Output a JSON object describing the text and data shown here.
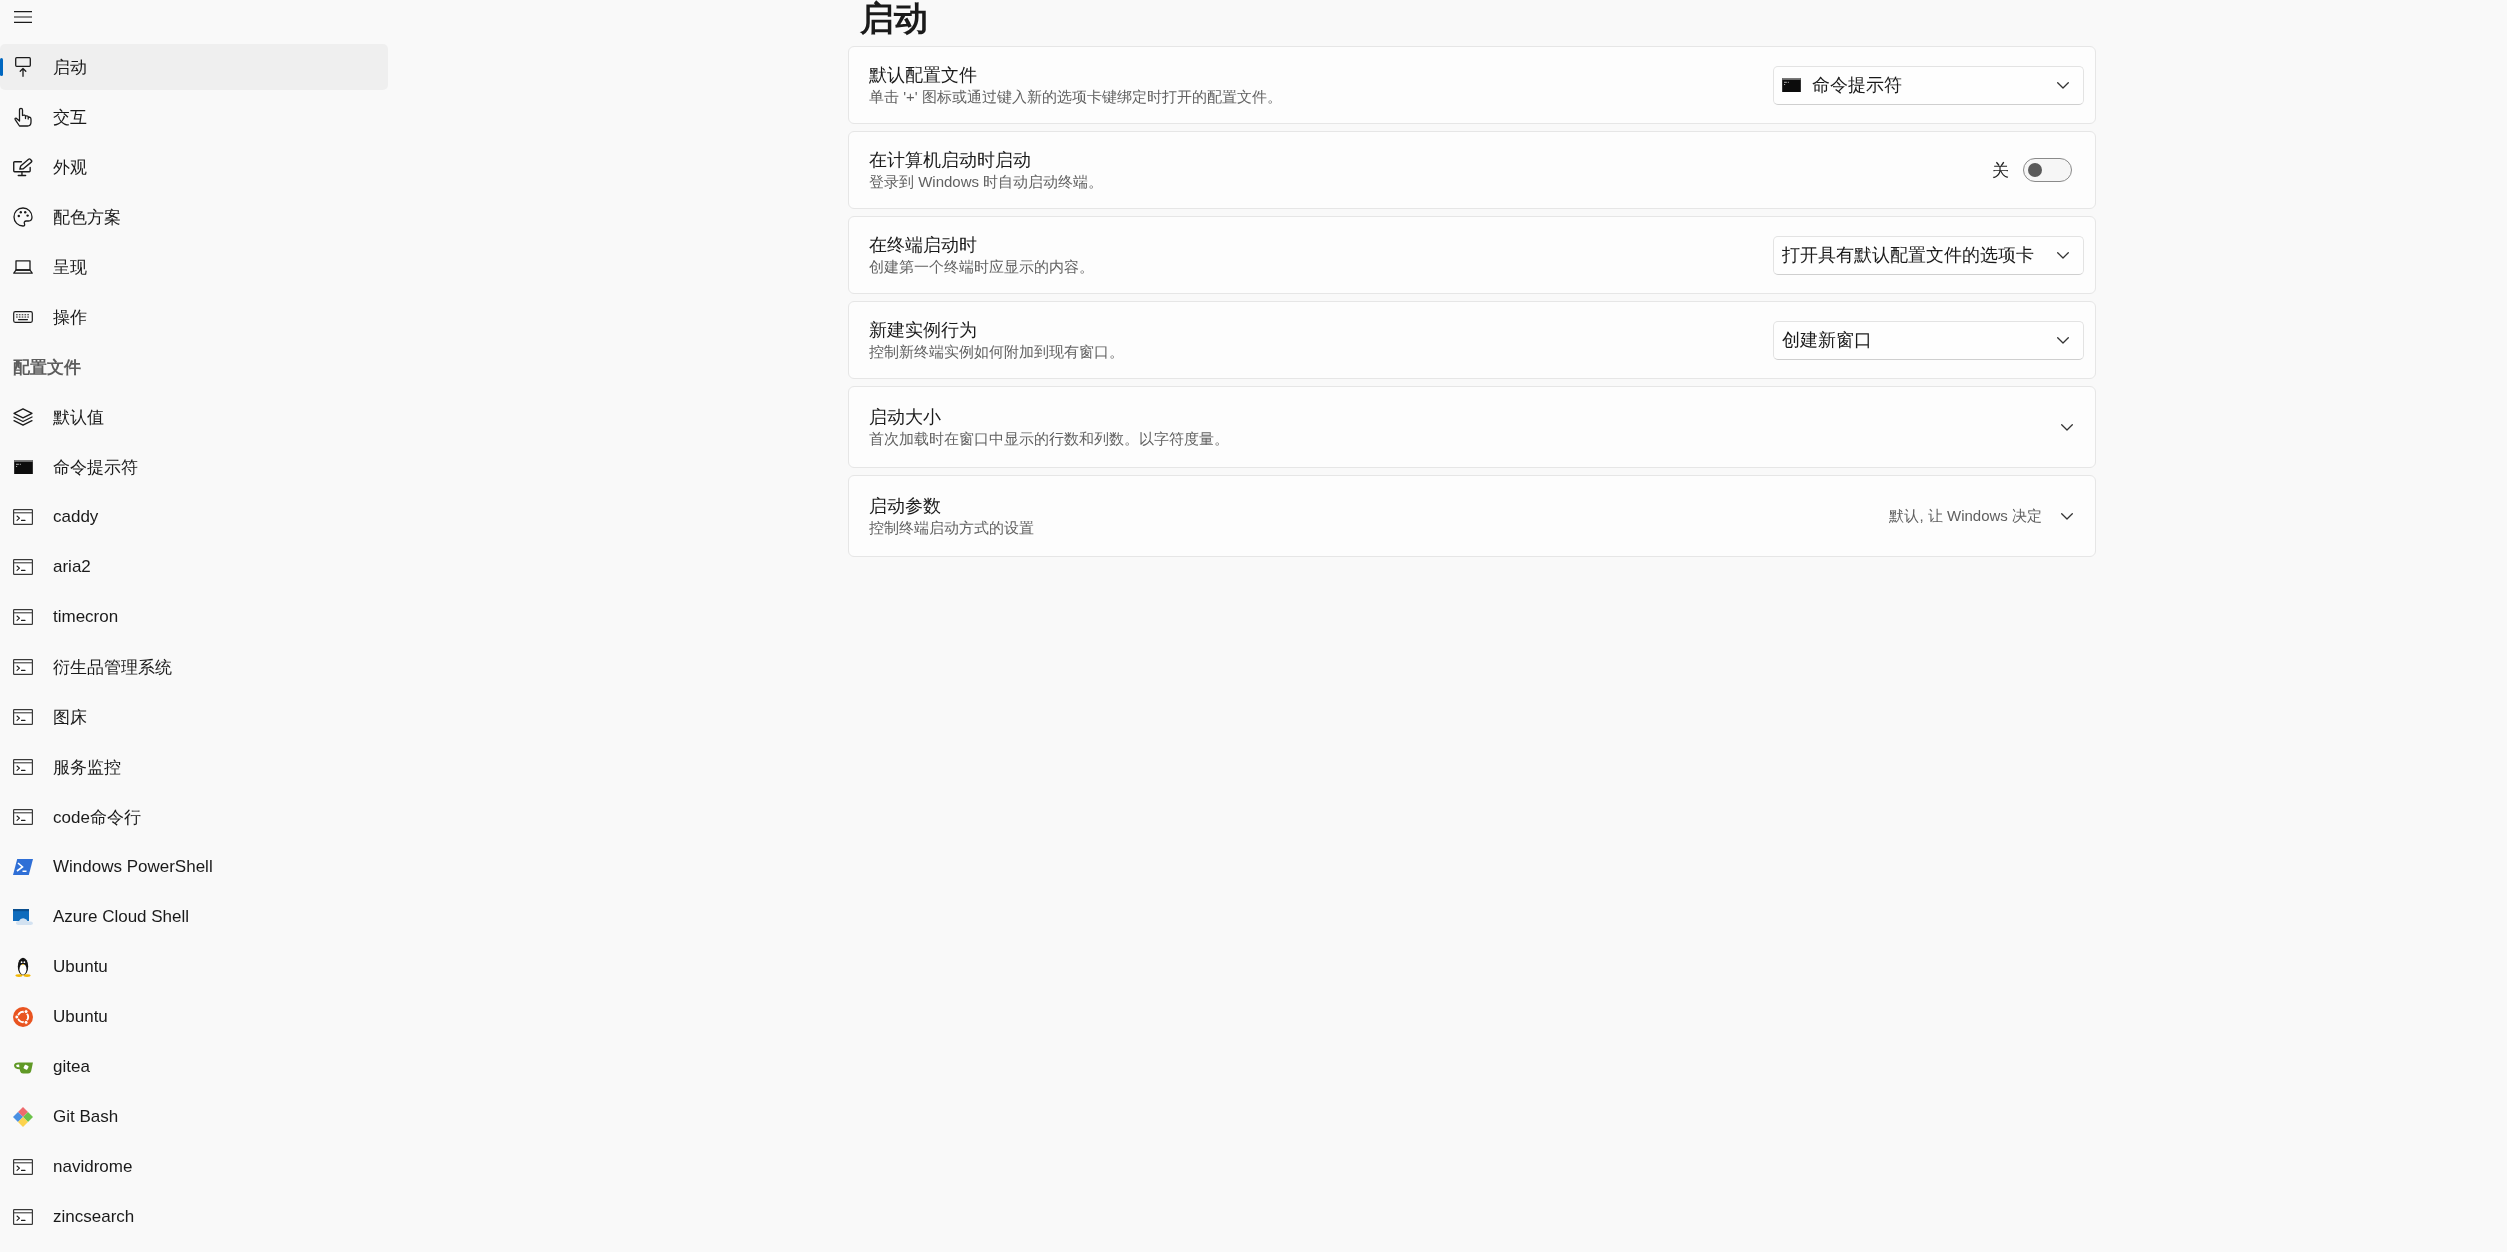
{
  "sidebar": {
    "items": [
      {
        "label": "启动",
        "kind": "startup",
        "selected": true
      },
      {
        "label": "交互",
        "kind": "interaction",
        "selected": false
      },
      {
        "label": "外观",
        "kind": "appearance",
        "selected": false
      },
      {
        "label": "配色方案",
        "kind": "palette",
        "selected": false
      },
      {
        "label": "呈现",
        "kind": "rendering",
        "selected": false
      },
      {
        "label": "操作",
        "kind": "actions",
        "selected": false
      }
    ],
    "section_header": "配置文件",
    "profiles": [
      {
        "label": "默认值",
        "kind": "defaults",
        "selected": false
      },
      {
        "label": "命令提示符",
        "kind": "terminal",
        "selected": false
      },
      {
        "label": "caddy",
        "kind": "console",
        "selected": false
      },
      {
        "label": "aria2",
        "kind": "console",
        "selected": false
      },
      {
        "label": "timecron",
        "kind": "console",
        "selected": false
      },
      {
        "label": "衍生品管理系统",
        "kind": "console",
        "selected": false
      },
      {
        "label": "图床",
        "kind": "console",
        "selected": false
      },
      {
        "label": "服务监控",
        "kind": "console",
        "selected": false
      },
      {
        "label": "code命令行",
        "kind": "console",
        "selected": false
      },
      {
        "label": "Windows PowerShell",
        "kind": "powershell",
        "selected": false
      },
      {
        "label": "Azure Cloud Shell",
        "kind": "cloud",
        "selected": false
      },
      {
        "label": "Ubuntu",
        "kind": "penguin",
        "selected": false
      },
      {
        "label": "Ubuntu",
        "kind": "ubuntu",
        "selected": false
      },
      {
        "label": "gitea",
        "kind": "teacup",
        "selected": false
      },
      {
        "label": "Git Bash",
        "kind": "diamond",
        "selected": false
      },
      {
        "label": "navidrome",
        "kind": "console",
        "selected": false
      },
      {
        "label": "zincsearch",
        "kind": "console",
        "selected": false
      }
    ]
  },
  "page": {
    "title": "启动",
    "settings": [
      {
        "kind": "dropdown",
        "title": "默认配置文件",
        "description": "单击 '+' 图标或通过键入新的选项卡键绑定时打开的配置文件。",
        "option": {
          "label": "命令提示符",
          "kind": "terminal"
        }
      },
      {
        "kind": "toggle",
        "title": "在计算机启动时启动",
        "description": "登录到 Windows 时自动启动终端。",
        "on": false,
        "state_label": "关"
      },
      {
        "kind": "dropdown",
        "title": "在终端启动时",
        "description": "创建第一个终端时应显示的内容。",
        "option": {
          "label": "打开具有默认配置文件的选项卡",
          "kind": "text"
        }
      },
      {
        "kind": "dropdown",
        "title": "新建实例行为",
        "description": "控制新终端实例如何附加到现有窗口。",
        "option": {
          "label": "创建新窗口",
          "kind": "text"
        }
      },
      {
        "kind": "expander",
        "title": "启动大小",
        "description": "首次加载时在窗口中显示的行数和列数。以字符度量。",
        "expanded": false
      },
      {
        "kind": "expander",
        "title": "启动参数",
        "description": "控制终端启动方式的设置",
        "summary": "默认, 让 Windows 决定",
        "expanded": false
      }
    ]
  }
}
